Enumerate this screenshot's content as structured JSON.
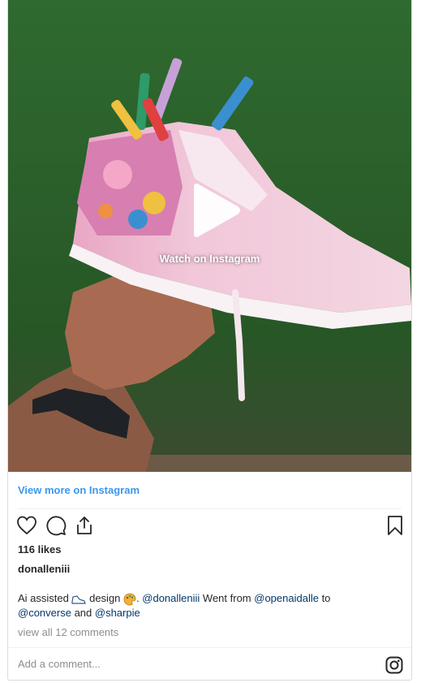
{
  "media": {
    "watch_label": "Watch on Instagram"
  },
  "post": {
    "view_more": "View more on Instagram",
    "likes": "116 likes",
    "username": "donalleniii",
    "caption": {
      "part1": "Ai assisted ",
      "part2": " design ",
      "part3": ". ",
      "mention1": "@donalleniii",
      "part4": " Went from ",
      "mention2": "@openaidalle",
      "part5": " to ",
      "mention3": "@converse",
      "part6": " and ",
      "mention4": "@sharpie"
    },
    "comments_link": "view all 12 comments",
    "comment_placeholder": "Add a comment..."
  },
  "icons": {
    "like": "heart-icon",
    "comment": "comment-icon",
    "share": "share-icon",
    "save": "bookmark-icon",
    "instagram": "instagram-icon"
  },
  "colors": {
    "link": "#3897f0",
    "mention": "#00376b",
    "muted": "#8e8e8e",
    "text": "#262626"
  }
}
